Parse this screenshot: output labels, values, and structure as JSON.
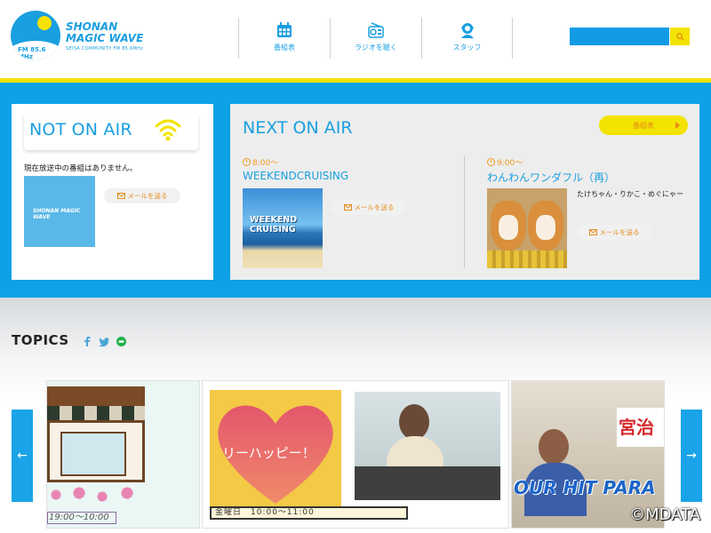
{
  "header": {
    "logo_line1": "SHONAN",
    "logo_line2": "MAGIC WAVE",
    "logo_tagline": "SEISA COMMUNITY FM 85.6MHz",
    "logo_freq": "FM 85.6 MHz",
    "nav": [
      {
        "label": "番組表",
        "icon": "calendar-icon"
      },
      {
        "label": "ラジオを聴く",
        "icon": "radio-icon"
      },
      {
        "label": "スタッフ",
        "icon": "staff-icon"
      }
    ],
    "search_placeholder": "",
    "search_icon": "search-icon"
  },
  "now": {
    "title": "NOT ON AIR",
    "message": "現在放送中の番組はありません。",
    "thumb_text": "SHONAN MAGIC WAVE",
    "mail_label": "メールを送る"
  },
  "next": {
    "title": "NEXT ON AIR",
    "schedule_button": "番組表",
    "programs": [
      {
        "time": "8:00〜",
        "title": "WEEKENDCRUISING",
        "thumb_text": "WEEKEND CRUISING",
        "mail_label": "メールを送る"
      },
      {
        "time": "9:00〜",
        "title": "わんわんワンダフル（再）",
        "cast": "たけちゃん・りかこ・めぐにゃー",
        "mail_label": "メールを送る"
      }
    ]
  },
  "topics": {
    "title": "TOPICS",
    "sns": [
      "facebook-icon",
      "twitter-icon",
      "line-icon"
    ],
    "cards": [
      {
        "caption": "19:00〜10:00"
      },
      {
        "heart_text": "リーハッピー！",
        "caption": "金曜日　10:00〜11:00"
      },
      {
        "banner": "OUR HIT PARA",
        "sign": "宮治"
      }
    ],
    "prev_label": "←",
    "next_label": "→"
  },
  "copyright": "©MDATA",
  "colors": {
    "brand_blue": "#0ea1e6",
    "accent_yellow": "#f3e300",
    "orange": "#f29a1f"
  }
}
